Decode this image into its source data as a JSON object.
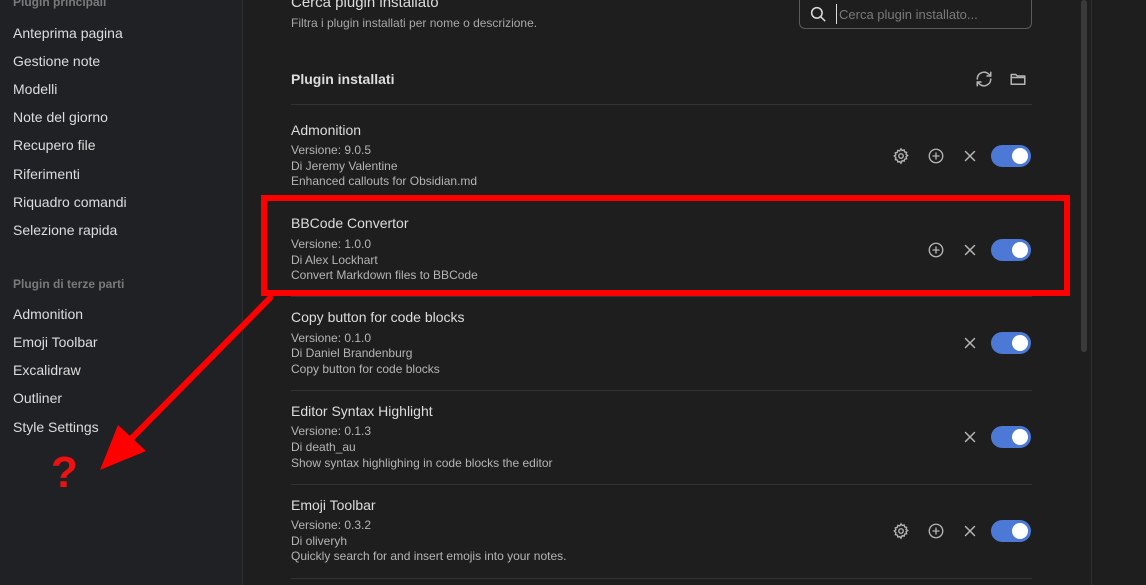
{
  "sidebar": {
    "core_heading": "Plugin principali",
    "core_items": [
      {
        "label": "Anteprima pagina"
      },
      {
        "label": "Gestione note"
      },
      {
        "label": "Modelli"
      },
      {
        "label": "Note del giorno"
      },
      {
        "label": "Recupero file"
      },
      {
        "label": "Riferimenti"
      },
      {
        "label": "Riquadro comandi"
      },
      {
        "label": "Selezione rapida"
      }
    ],
    "community_heading": "Plugin di terze parti",
    "community_items": [
      {
        "label": "Admonition"
      },
      {
        "label": "Emoji Toolbar"
      },
      {
        "label": "Excalidraw"
      },
      {
        "label": "Outliner"
      },
      {
        "label": "Style Settings"
      }
    ]
  },
  "search": {
    "title": "Cerca plugin installato",
    "description": "Filtra i plugin installati per nome o descrizione.",
    "placeholder": "Cerca plugin installato..."
  },
  "installed": {
    "heading": "Plugin installati",
    "plugins": [
      {
        "name": "Admonition",
        "version": "Versione: 9.0.5",
        "author": "Di Jeremy Valentine",
        "description": "Enhanced callouts for Obsidian.md",
        "enabled": true
      },
      {
        "name": "BBCode Convertor",
        "version": "Versione: 1.0.0",
        "author": "Di Alex Lockhart",
        "description": "Convert Markdown files to BBCode",
        "enabled": true
      },
      {
        "name": "Copy button for code blocks",
        "version": "Versione: 0.1.0",
        "author": "Di Daniel Brandenburg",
        "description": "Copy button for code blocks",
        "enabled": true
      },
      {
        "name": "Editor Syntax Highlight",
        "version": "Versione: 0.1.3",
        "author": "Di death_au",
        "description": "Show syntax highlighing in code blocks the editor",
        "enabled": true
      },
      {
        "name": "Emoji Toolbar",
        "version": "Versione: 0.3.2",
        "author": "Di oliveryh",
        "description": "Quickly search for and insert emojis into your notes.",
        "enabled": true
      }
    ]
  },
  "annotation": {
    "question_mark": "?",
    "color": "#ff0000"
  },
  "colors": {
    "accent": "#4d79d6",
    "background": "#1e1e1e",
    "sidebar_background": "#202124"
  }
}
